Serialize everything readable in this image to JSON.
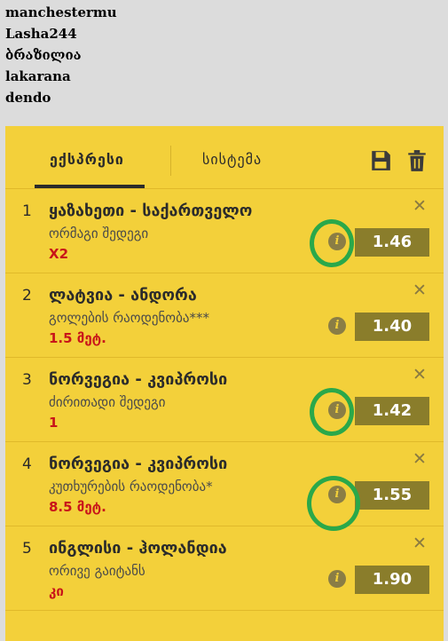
{
  "users": [
    "manchestermu",
    "Lasha244",
    "ბრაზილია",
    "lakarana",
    "dendo"
  ],
  "tabs": {
    "express": "ექსპრესი",
    "system": "სისტემა"
  },
  "colors": {
    "panel": "#f3d03a",
    "odds_bg": "#8a7d2b",
    "pick": "#c8141a",
    "highlight": "#2aa84a"
  },
  "bets": [
    {
      "num": "1",
      "title": "ყაზახეთი - საქართველო",
      "market": "ორმაგი შედეგი",
      "pick": "X2",
      "odds": "1.46"
    },
    {
      "num": "2",
      "title": "ლატვია - ანდორა",
      "market": "გოლების რაოდენობა***",
      "pick": "1.5 მეტ.",
      "odds": "1.40"
    },
    {
      "num": "3",
      "title": "ნორვეგია - კვიპროსი",
      "market": "ძირითადი შედეგი",
      "pick": "1",
      "odds": "1.42"
    },
    {
      "num": "4",
      "title": "ნორვეგია - კვიპროსი",
      "market": "კუთხურების რაოდენობა*",
      "pick": "8.5 მეტ.",
      "odds": "1.55"
    },
    {
      "num": "5",
      "title": "ინგლისი - ჰოლანდია",
      "market": "ორივე გაიტანს",
      "pick": "კი",
      "odds": "1.90"
    }
  ],
  "icons": {
    "save": "save-icon",
    "delete": "trash-icon",
    "info": "info-icon",
    "remove": "close-icon"
  }
}
